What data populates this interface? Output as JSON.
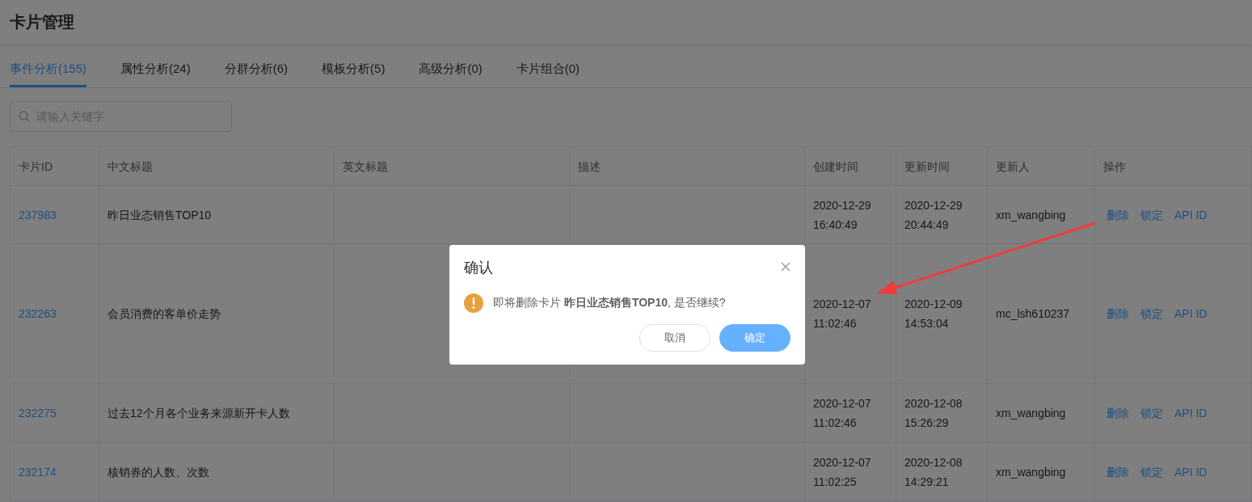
{
  "page_title": "卡片管理",
  "tabs": [
    {
      "label": "事件分析(155)",
      "selected": true
    },
    {
      "label": "属性分析(24)",
      "selected": false
    },
    {
      "label": "分群分析(6)",
      "selected": false
    },
    {
      "label": "模板分析(5)",
      "selected": false
    },
    {
      "label": "高级分析(0)",
      "selected": false
    },
    {
      "label": "卡片组合(0)",
      "selected": false
    }
  ],
  "search": {
    "placeholder": "请输入关键字"
  },
  "table": {
    "columns": [
      "卡片ID",
      "中文标题",
      "英文标题",
      "描述",
      "创建时间",
      "更新时间",
      "更新人",
      "操作"
    ],
    "rows": [
      {
        "id": "237983",
        "title_cn": "昨日业态销售TOP10",
        "created": "2020-12-29 16:40:49",
        "updated": "2020-12-29 20:44:49",
        "updater": "xm_wangbing",
        "actions": [
          "删除",
          "锁定",
          "API ID"
        ]
      },
      {
        "id": "232263",
        "title_cn": "会员消费的客单价走势",
        "created": "2020-12-07 11:02:46",
        "updated": "2020-12-09 14:53:04",
        "updater": "mc_lsh610237",
        "actions": [
          "删除",
          "锁定",
          "API ID"
        ]
      },
      {
        "id": "232275",
        "title_cn": "过去12个月各个业务来源新开卡人数",
        "created": "2020-12-07 11:02:46",
        "updated": "2020-12-08 15:26:29",
        "updater": "xm_wangbing",
        "actions": [
          "删除",
          "锁定",
          "API ID"
        ]
      },
      {
        "id": "232174",
        "title_cn": "核销券的人数、次数",
        "created": "2020-12-07 11:02:25",
        "updated": "2020-12-08 14:29:21",
        "updater": "xm_wangbing",
        "actions": [
          "删除",
          "锁定",
          "API ID"
        ]
      }
    ]
  },
  "dialog": {
    "title": "确认",
    "message": "即将删除卡片 **昨日业态销售TOP10**, 是否继续?",
    "buttons": [
      {
        "label": "取消",
        "kind": "secondary"
      },
      {
        "label": "确定",
        "kind": "primary"
      }
    ]
  }
}
